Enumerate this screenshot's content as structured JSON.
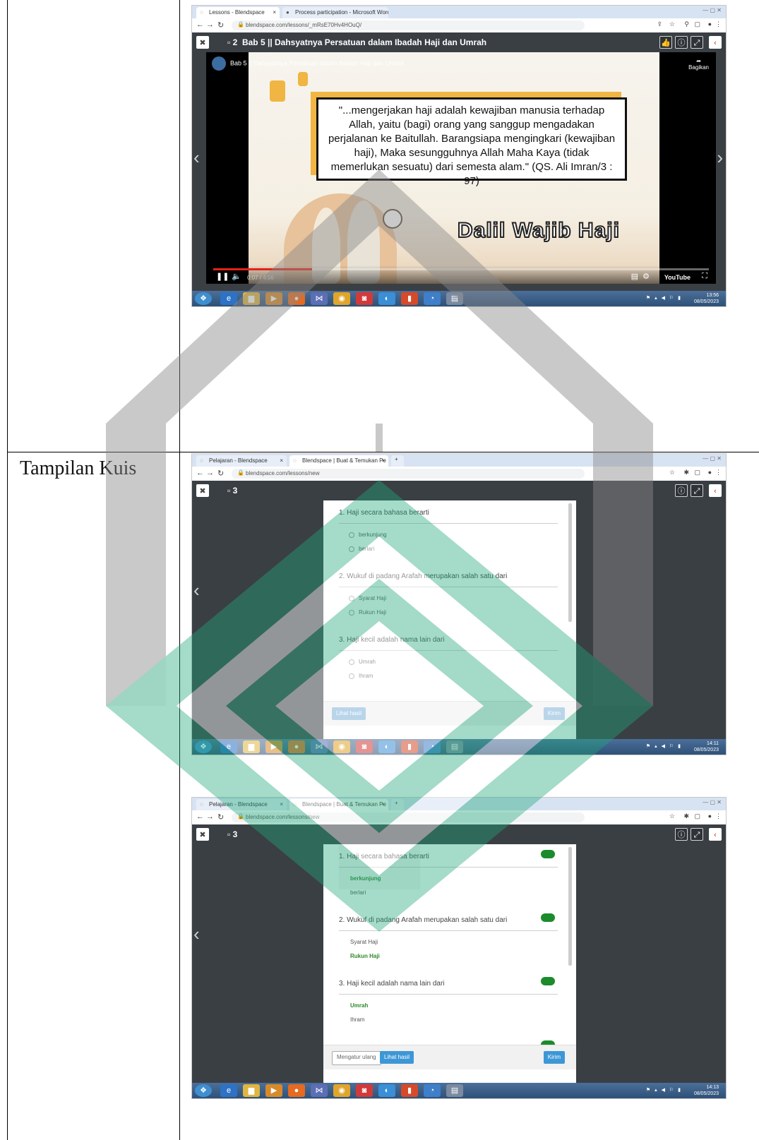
{
  "table": {
    "row2_label": "Tampilan Kuis"
  },
  "shot1": {
    "tabs": [
      "Lessons - Blendspace",
      "Process participation - Microsoft Word"
    ],
    "url": "blendspace.com/lessons/_mRsE70Hv4HOuQ/",
    "tile_number": "2",
    "title": "Bab 5 || Dahsyatnya Persatuan dalam Ibadah Haji dan Umrah",
    "video": {
      "channel_title": "Bab 5 || Dahsyatnya Persatuan dalam Ibadah Haji dan Umrah",
      "share_label": "Bagikan",
      "quote": "\"...mengerjakan haji adalah kewajiban manusia terhadap Allah, yaitu (bagi) orang yang sanggup mengadakan perjalanan ke Baitullah. Barangsiapa mengingkari (kewajiban haji), Maka sesungguhnya Allah Maha Kaya (tidak memerlukan sesuatu) dari semesta alam.\" (QS. Ali Imran/3 : 97)",
      "heading": "Dalil Wajib Haji",
      "time": "0:07 / 4:56",
      "youtube": "YouTube",
      "progress": 0.2
    },
    "clock_time": "13:56",
    "clock_date": "08/05/2023"
  },
  "shot2": {
    "tabs": [
      "Pelajaran - Blendspace",
      "Blendspace | Buat & Temukan Pe"
    ],
    "url": "blendspace.com/lessons/new",
    "tile_number": "3",
    "questions": [
      {
        "text": "1. Haji secara bahasa berarti",
        "options": [
          "berkunjung",
          "berlari"
        ]
      },
      {
        "text": "2. Wukuf di padang Arafah merupakan salah satu dari",
        "options": [
          "Syarat Haji",
          "Rukun Haji"
        ]
      },
      {
        "text": "3. Haji kecil adalah nama lain dari",
        "options": [
          "Umrah",
          "Ihram"
        ]
      }
    ],
    "footer_left": "Lihat hasil",
    "footer_right": "Kirim",
    "clock_time": "14:11",
    "clock_date": "08/05/2023"
  },
  "shot3": {
    "tabs": [
      "Pelajaran - Blendspace",
      "Blendspace | Buat & Temukan Pe"
    ],
    "url": "blendspace.com/lessons/new",
    "tile_number": "3",
    "questions": [
      {
        "text": "1. Haji secara bahasa berarti",
        "options": [
          "berkunjung",
          "berlari"
        ],
        "correct": 0
      },
      {
        "text": "2. Wukuf di padang Arafah merupakan salah satu dari",
        "options": [
          "Syarat Haji",
          "Rukun Haji"
        ],
        "correct": 1
      },
      {
        "text": "3. Haji kecil adalah nama lain dari",
        "options": [
          "Umrah",
          "Ihram"
        ],
        "correct": 0
      }
    ],
    "footer_reset": "Mengatur ulang",
    "footer_left": "Lihat hasil",
    "footer_right": "Kirim",
    "clock_time": "14:13",
    "clock_date": "08/05/2023"
  },
  "colors": {
    "watermark_green": "#1fa67a",
    "watermark_gray": "#8a8a8a",
    "accent_blue": "#3d97d6",
    "correct_green": "#1b8b2c"
  }
}
